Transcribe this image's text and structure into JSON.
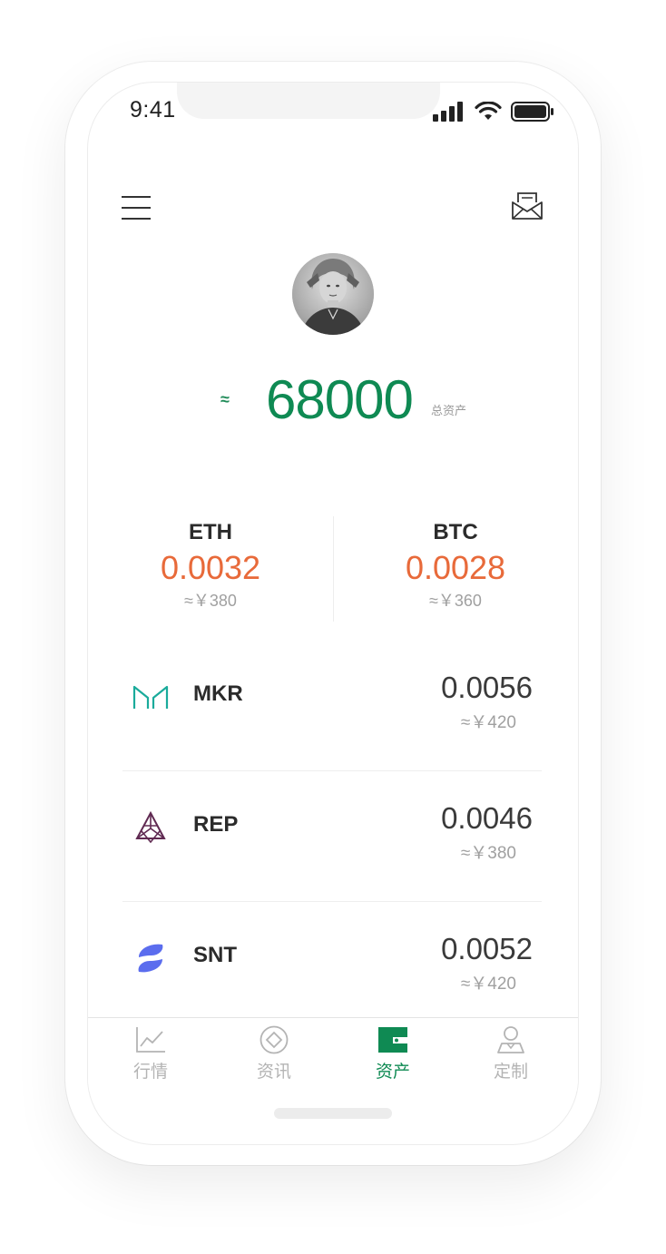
{
  "status_bar": {
    "time": "9:41"
  },
  "header": {
    "menu_icon": "hamburger-menu-icon",
    "mail_icon": "mail-envelope-icon"
  },
  "total": {
    "approx": "≈",
    "value": "68000",
    "label": "总资产"
  },
  "top_coins": [
    {
      "symbol": "ETH",
      "amount": "0.0032",
      "cny": "≈￥380"
    },
    {
      "symbol": "BTC",
      "amount": "0.0028",
      "cny": "≈￥360"
    }
  ],
  "coins": [
    {
      "symbol": "MKR",
      "amount": "0.0056",
      "cny": "≈￥420",
      "icon": "mkr-logo-icon",
      "color": "#1aab9b"
    },
    {
      "symbol": "REP",
      "amount": "0.0046",
      "cny": "≈￥380",
      "icon": "rep-logo-icon",
      "color": "#602a52"
    },
    {
      "symbol": "SNT",
      "amount": "0.0052",
      "cny": "≈￥420",
      "icon": "snt-logo-icon",
      "color": "#5b6dee"
    }
  ],
  "tabs": [
    {
      "label": "行情",
      "icon": "chart-line-icon",
      "active": false
    },
    {
      "label": "资讯",
      "icon": "news-diamond-icon",
      "active": false
    },
    {
      "label": "资产",
      "icon": "wallet-icon",
      "active": true
    },
    {
      "label": "定制",
      "icon": "profile-icon",
      "active": false
    }
  ],
  "colors": {
    "accent_green": "#0f8a53",
    "amount_orange": "#e86a3a",
    "muted_text": "#a0a0a0"
  }
}
